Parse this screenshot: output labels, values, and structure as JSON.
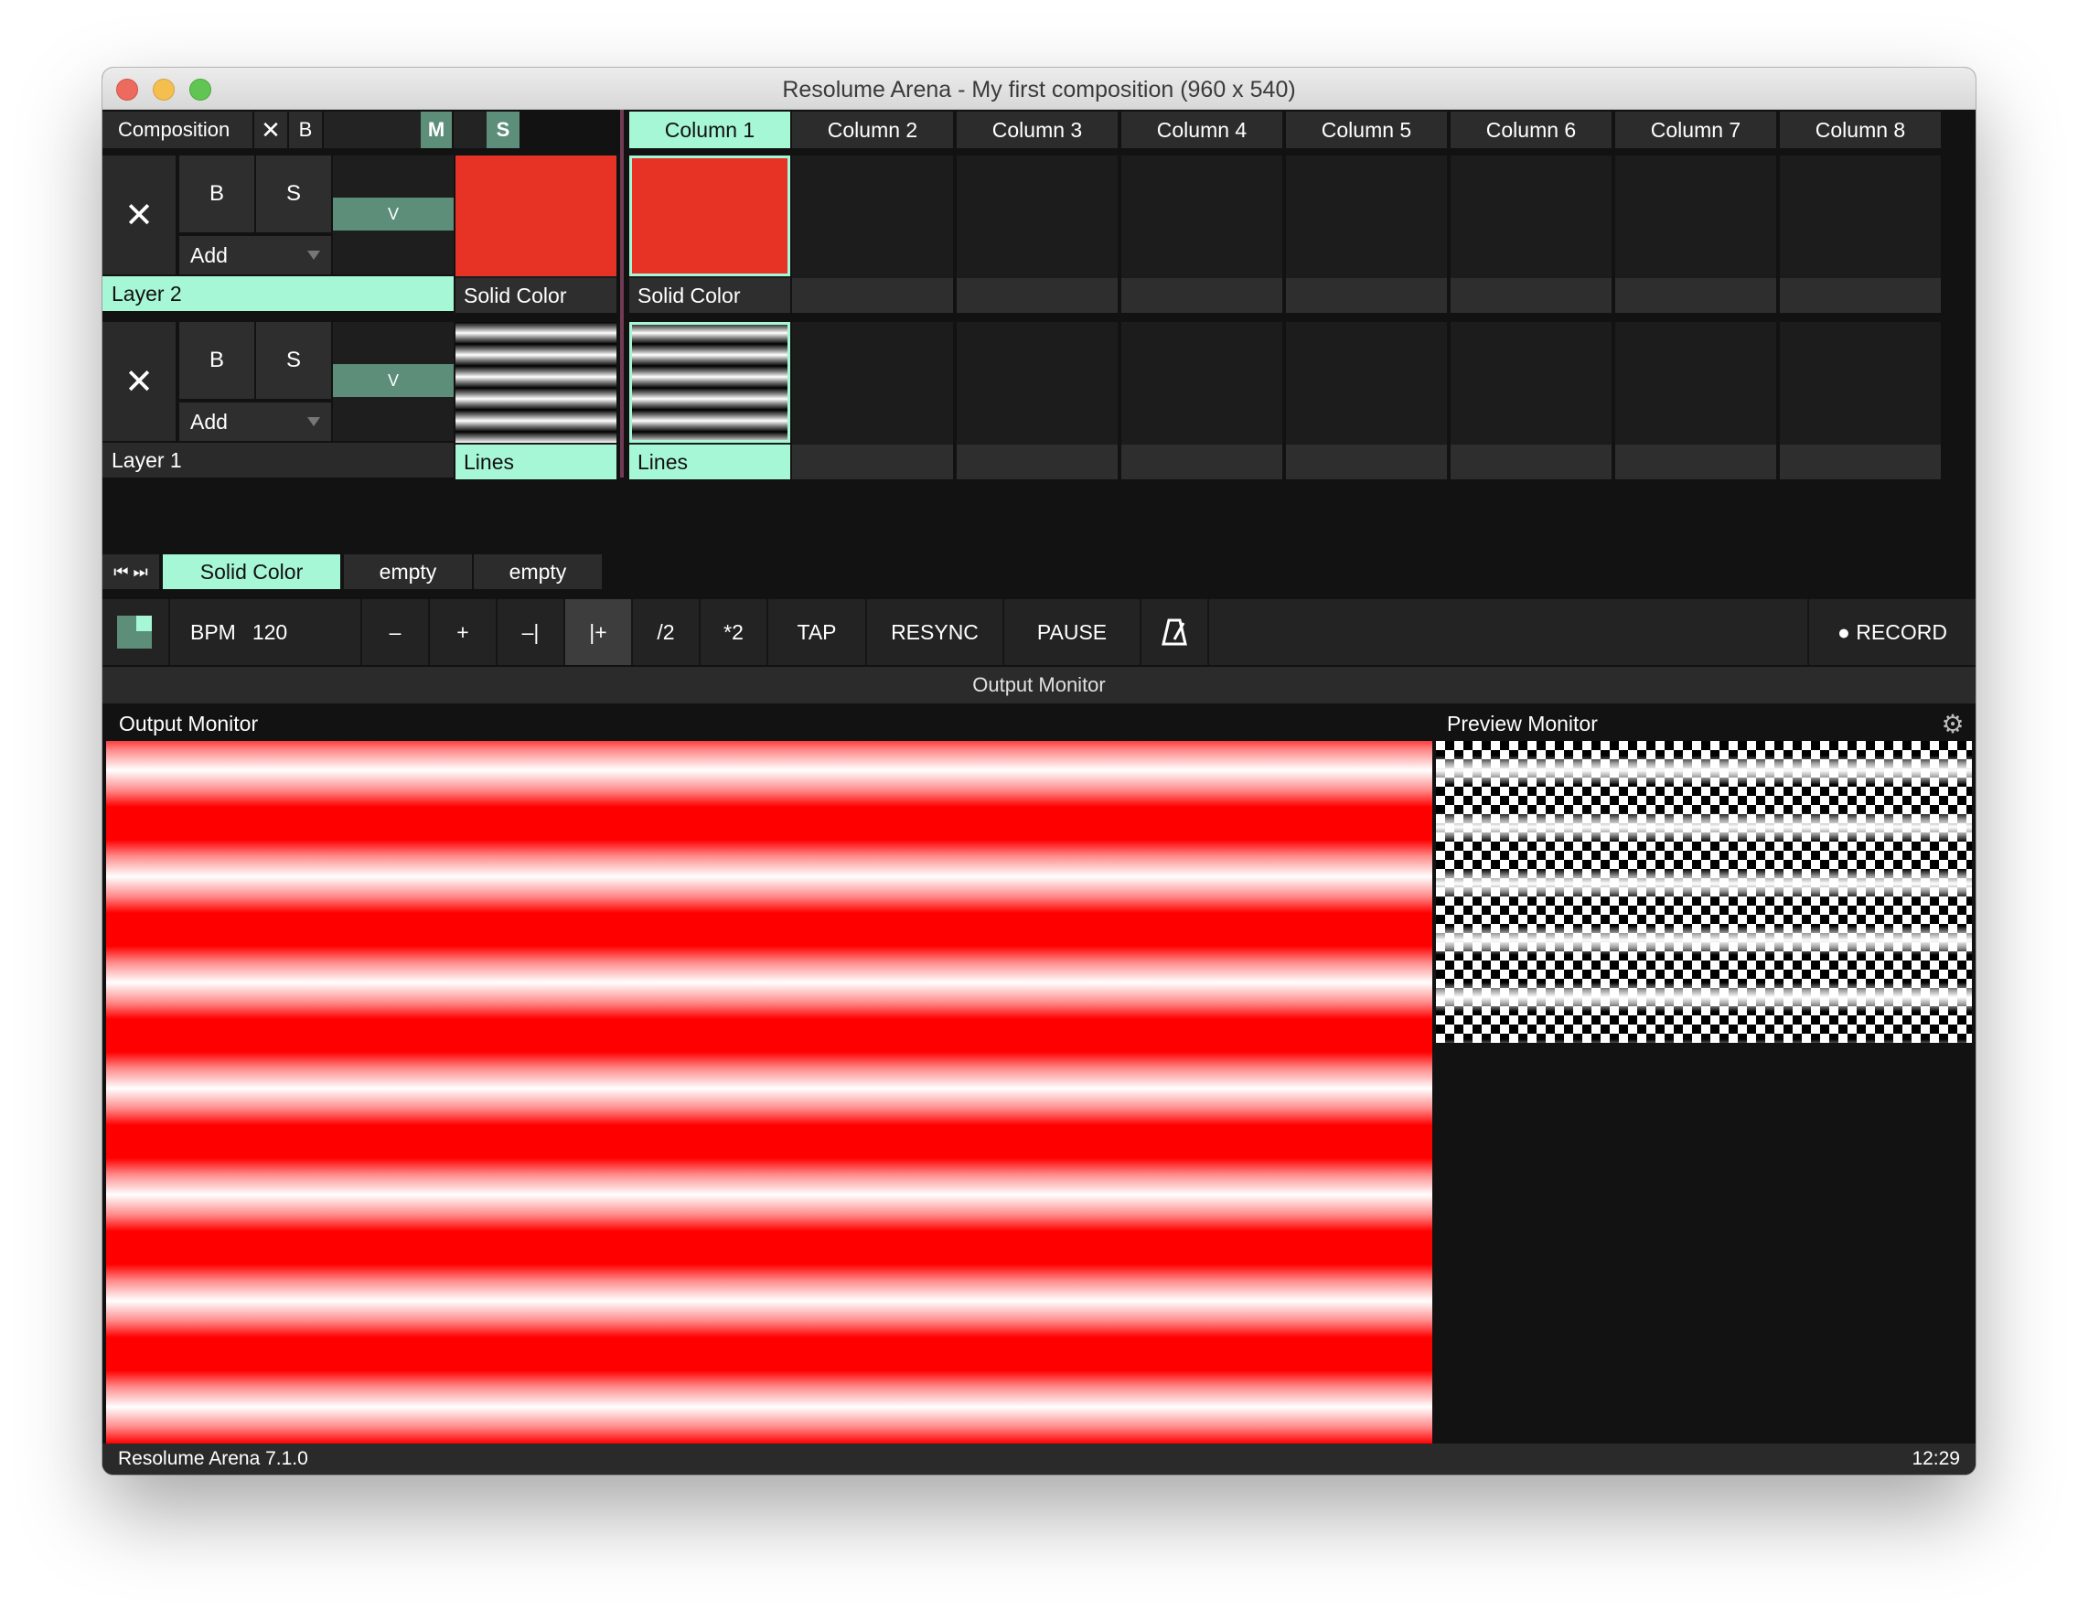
{
  "window": {
    "title": "Resolume Arena - My first composition (960 x 540)"
  },
  "composition": {
    "label": "Composition",
    "close": "✕",
    "b": "B",
    "m": "M",
    "s": "S"
  },
  "columns": [
    "Column 1",
    "Column 2",
    "Column 3",
    "Column 4",
    "Column 5",
    "Column 6",
    "Column 7",
    "Column 8"
  ],
  "active_column": "Column 1",
  "layers": [
    {
      "name": "Layer 2",
      "close": "✕",
      "b": "B",
      "s": "S",
      "v": "V",
      "add": "Add",
      "active": true,
      "preview_clip": "Solid Color",
      "clips": [
        "Solid Color",
        "",
        "",
        "",
        "",
        "",
        "",
        ""
      ]
    },
    {
      "name": "Layer 1",
      "close": "✕",
      "b": "B",
      "s": "S",
      "v": "V",
      "add": "Add",
      "active": false,
      "preview_clip": "Lines",
      "clips": [
        "Lines",
        "",
        "",
        "",
        "",
        "",
        "",
        ""
      ]
    }
  ],
  "deck": {
    "nav": "⏮ ⏭",
    "tabs": [
      "Solid Color",
      "empty",
      "empty"
    ]
  },
  "transport": {
    "bpm_label": "BPM",
    "bpm_value": "120",
    "buttons": [
      "–",
      "+",
      "–|",
      "|+",
      "/2",
      "*2",
      "TAP",
      "RESYNC",
      "PAUSE"
    ],
    "metronome": "metronome-icon",
    "record": "● RECORD"
  },
  "panel": {
    "title": "Output Monitor",
    "output_label": "Output Monitor",
    "preview_label": "Preview Monitor"
  },
  "status": {
    "version": "Resolume Arena 7.1.0",
    "time": "12:29"
  },
  "colors": {
    "accent": "#a6f7d6",
    "toggle": "#5c8e7a",
    "solid_color": "#e63326"
  }
}
